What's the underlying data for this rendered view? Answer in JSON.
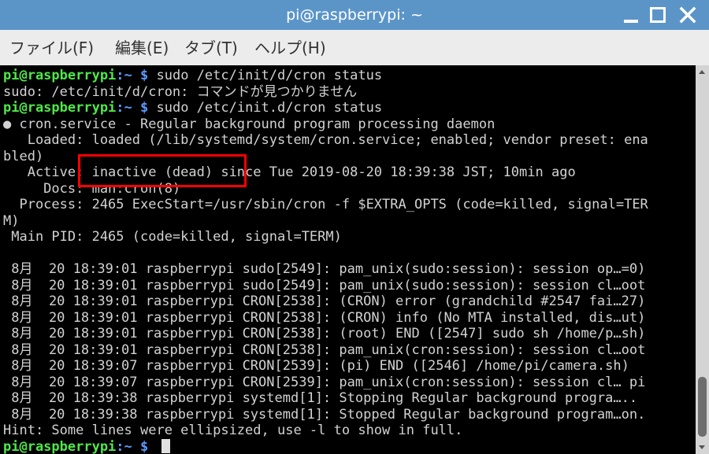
{
  "window": {
    "title": "pi@raspberrypi: ~"
  },
  "menu": {
    "file": "ファイル(F)",
    "edit": "編集(E)",
    "tab": "タブ(T)",
    "help": "ヘルプ(H)"
  },
  "prompt": {
    "user_host": "pi@raspberrypi",
    "path_sep": ":~ $ "
  },
  "terminal": {
    "lines": [
      {
        "type": "prompt",
        "text": "sudo /etc/init/d/cron status"
      },
      {
        "type": "out",
        "text": "sudo: /etc/init/d/cron: コマンドが見つかりません"
      },
      {
        "type": "prompt",
        "text": "sudo /etc/init.d/cron status"
      },
      {
        "type": "out",
        "text": "● cron.service - Regular background program processing daemon"
      },
      {
        "type": "out",
        "text": "   Loaded: loaded (/lib/systemd/system/cron.service; enabled; vendor preset: ena"
      },
      {
        "type": "out",
        "text": "bled)"
      },
      {
        "type": "out",
        "text": "   Active: inactive (dead) since Tue 2019-08-20 18:39:38 JST; 10min ago"
      },
      {
        "type": "out",
        "text": "     Docs: man:cron(8)"
      },
      {
        "type": "out",
        "text": "  Process: 2465 ExecStart=/usr/sbin/cron -f $EXTRA_OPTS (code=killed, signal=TER"
      },
      {
        "type": "out",
        "text": "M)"
      },
      {
        "type": "out",
        "text": " Main PID: 2465 (code=killed, signal=TERM)"
      },
      {
        "type": "out",
        "text": ""
      },
      {
        "type": "out",
        "text": " 8月  20 18:39:01 raspberrypi sudo[2549]: pam_unix(sudo:session): session op…=0)"
      },
      {
        "type": "out",
        "text": " 8月  20 18:39:01 raspberrypi sudo[2549]: pam_unix(sudo:session): session cl…oot"
      },
      {
        "type": "out",
        "text": " 8月  20 18:39:01 raspberrypi CRON[2538]: (CRON) error (grandchild #2547 fai…27)"
      },
      {
        "type": "out",
        "text": " 8月  20 18:39:01 raspberrypi CRON[2538]: (CRON) info (No MTA installed, dis…ut)"
      },
      {
        "type": "out",
        "text": " 8月  20 18:39:01 raspberrypi CRON[2538]: (root) END ([2547] sudo sh /home/p…sh)"
      },
      {
        "type": "out",
        "text": " 8月  20 18:39:01 raspberrypi CRON[2538]: pam_unix(cron:session): session cl…oot"
      },
      {
        "type": "out",
        "text": " 8月  20 18:39:07 raspberrypi CRON[2539]: (pi) END ([2546] /home/pi/camera.sh)"
      },
      {
        "type": "out",
        "text": " 8月  20 18:39:07 raspberrypi CRON[2539]: pam_unix(cron:session): session cl… pi"
      },
      {
        "type": "out",
        "text": " 8月  20 18:39:38 raspberrypi systemd[1]: Stopping Regular background progra….."
      },
      {
        "type": "out",
        "text": " 8月  20 18:39:38 raspberrypi systemd[1]: Stopped Regular background program…on."
      },
      {
        "type": "out",
        "text": "Hint: Some lines were ellipsized, use -l to show in full."
      },
      {
        "type": "prompt",
        "text": ""
      }
    ]
  },
  "colors": {
    "titlebar": "#5b95c8",
    "prompt_user": "#4fe84a",
    "prompt_path": "#5b9bff",
    "highlight": "#ff0000"
  },
  "icons": {
    "minimize": "minimize-icon",
    "maximize": "maximize-icon",
    "close": "close-icon"
  }
}
